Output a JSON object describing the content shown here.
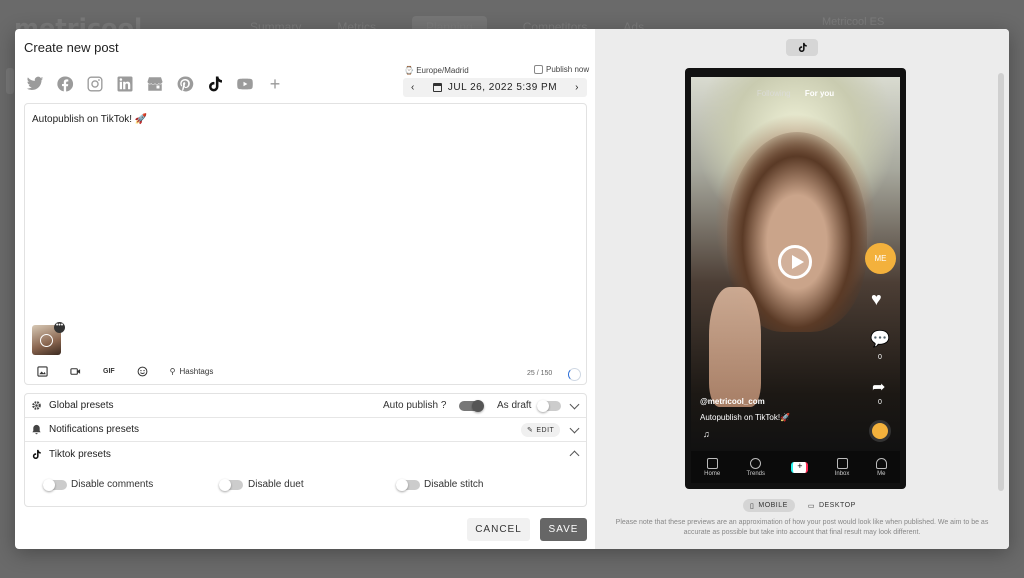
{
  "background": {
    "logo": "metricool",
    "nav": [
      "Summary",
      "Metrics",
      "Planning",
      "Competitors",
      "Ads"
    ],
    "nav_active_index": 2,
    "user": "Metricool ES"
  },
  "modal": {
    "title": "Create new post",
    "networks": [
      {
        "name": "twitter-icon",
        "active": false
      },
      {
        "name": "facebook-icon",
        "active": false
      },
      {
        "name": "instagram-icon",
        "active": false
      },
      {
        "name": "linkedin-icon",
        "active": false
      },
      {
        "name": "google-business-icon",
        "active": false
      },
      {
        "name": "pinterest-icon",
        "active": false
      },
      {
        "name": "tiktok-icon",
        "active": true
      },
      {
        "name": "youtube-icon",
        "active": false
      }
    ],
    "timezone": "Europe/Madrid",
    "publish_now": "Publish now",
    "date": "JUL 26, 2022 5:39 PM",
    "post_text": "Autopublish on TikTok! 🚀",
    "toolbar": {
      "gif": "GIF",
      "hashtags": "Hashtags"
    },
    "counter": "25 / 150",
    "presets": {
      "global": "Global presets",
      "auto_publish": "Auto publish",
      "auto_publish_q": "?",
      "auto_publish_on": true,
      "as_draft": "As draft",
      "as_draft_on": false,
      "notifications": "Notifications presets",
      "edit": "EDIT",
      "tiktok": "Tiktok presets",
      "disable_comments": "Disable comments",
      "disable_duet": "Disable duet",
      "disable_stitch": "Disable stitch"
    },
    "cancel": "CANCEL",
    "save": "SAVE"
  },
  "preview": {
    "tabs": [
      "Following",
      "For you"
    ],
    "avatar_text": "ME",
    "comment_count": "0",
    "share_count": "0",
    "username": "@metricool_com",
    "caption": "Autopublish on TikTok!🚀",
    "nav": [
      "Home",
      "Trends",
      "",
      "Inbox",
      "Me"
    ],
    "mobile": "MOBILE",
    "desktop": "DESKTOP",
    "disclaimer": "Please note that these previews are an approximation of how your post would look like when published. We aim to be as accurate as possible but take into account that final result may look different."
  },
  "colors": {
    "accent": "#666666",
    "avatar": "#f3b13c",
    "progress": "#2d6fd8"
  }
}
